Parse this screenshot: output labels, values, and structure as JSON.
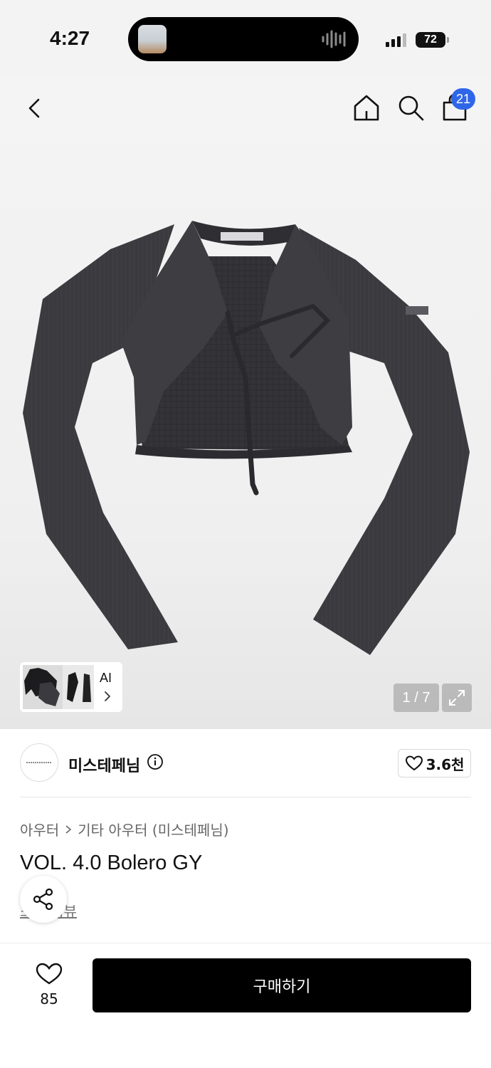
{
  "status_bar": {
    "time": "4:27",
    "battery": "72"
  },
  "header": {
    "cart_count": "21"
  },
  "gallery": {
    "thumb_label": "AI",
    "page_indicator": "1 / 7"
  },
  "brand": {
    "name": "미스테페님",
    "likes": "3.6천"
  },
  "product": {
    "breadcrumb": [
      "아우터",
      "기타 아우터 (미스테페님)"
    ],
    "title": "VOL. 4.0 Bolero GY",
    "sub_link": "스냅 리뷰"
  },
  "bottom": {
    "like_count": "85",
    "buy_label": "구매하기"
  },
  "colors": {
    "badge": "#2f66e8",
    "buy_button": "#000000",
    "garment": "#3a3a3f"
  }
}
